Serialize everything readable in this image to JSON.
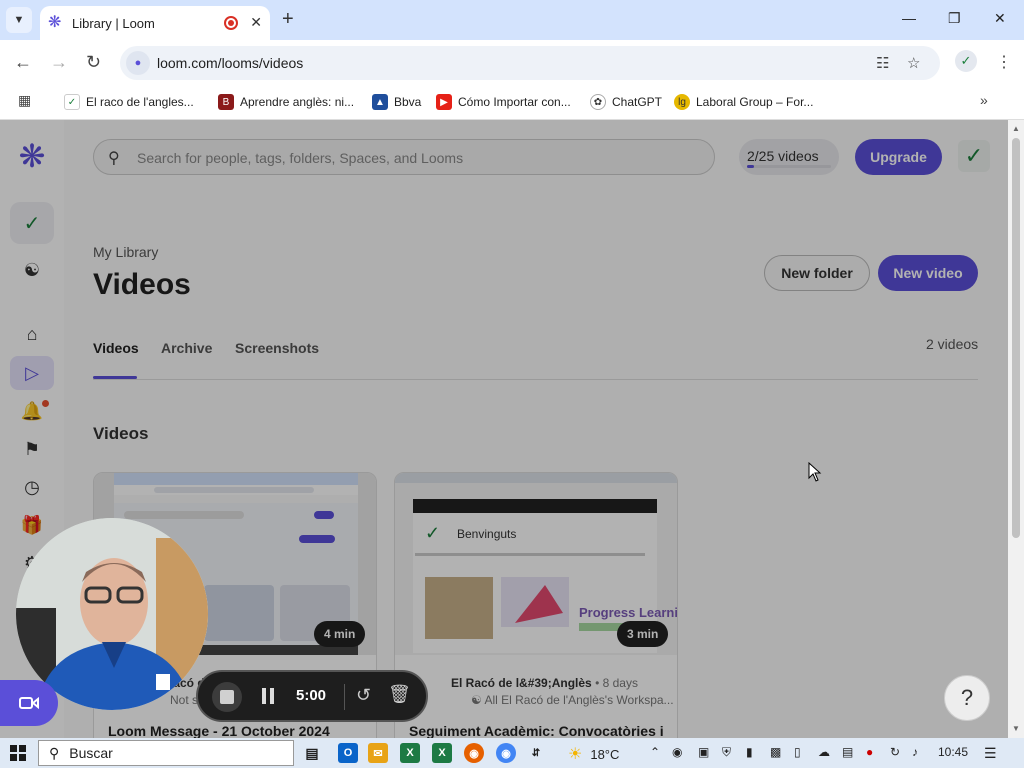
{
  "browser": {
    "tab_title": "Library | Loom",
    "url": "loom.com/looms/videos",
    "new_tab": "+",
    "bookmarks": [
      {
        "label": "El raco de l'angles...",
        "color": "#1b7f3b",
        "icon": "checkmark-icon"
      },
      {
        "label": "Aprendre anglès: ni...",
        "color": "#8b1a1a",
        "icon": "book-icon"
      },
      {
        "label": "Bbva",
        "color": "#1f4e9c",
        "icon": "bbva-logo-icon"
      },
      {
        "label": "Cómo Importar con...",
        "color": "#e62117",
        "icon": "youtube-icon"
      },
      {
        "label": "ChatGPT",
        "color": "#333333",
        "icon": "chatgpt-icon"
      },
      {
        "label": "Laboral Group – For...",
        "color": "#e6b800",
        "icon": "lg-logo-icon"
      }
    ]
  },
  "loom": {
    "search_placeholder": "Search for people, tags, folders, Spaces, and Looms",
    "quota_label": "2/25 videos",
    "quota_fraction": 0.08,
    "upgrade_label": "Upgrade",
    "breadcrumb": "My Library",
    "page_title": "Videos",
    "new_folder_label": "New folder",
    "new_video_label": "New video",
    "tabs": [
      "Videos",
      "Archive",
      "Screenshots"
    ],
    "video_count": "2 videos",
    "section_title": "Videos",
    "help_label": "?",
    "accent": "#5b4fd8",
    "cards": [
      {
        "duration": "4 min",
        "author": "El Racó de l...",
        "meta": "Not shared",
        "title": "Loom Message - 21 October 2024"
      },
      {
        "duration": "3 min",
        "author": "El Racó de l&#39;Anglès",
        "age": "8 days",
        "meta": "All El Racó de l'Anglès's Workspa...",
        "title": "Seguiment Acadèmic: Convocatòries i",
        "thumb_heading": "Benvinguts",
        "thumb_label": "Progress Learni"
      }
    ]
  },
  "recorder": {
    "time": "5:00"
  },
  "taskbar": {
    "search_label": "Buscar",
    "temperature": "18°C",
    "time": "10:45"
  }
}
